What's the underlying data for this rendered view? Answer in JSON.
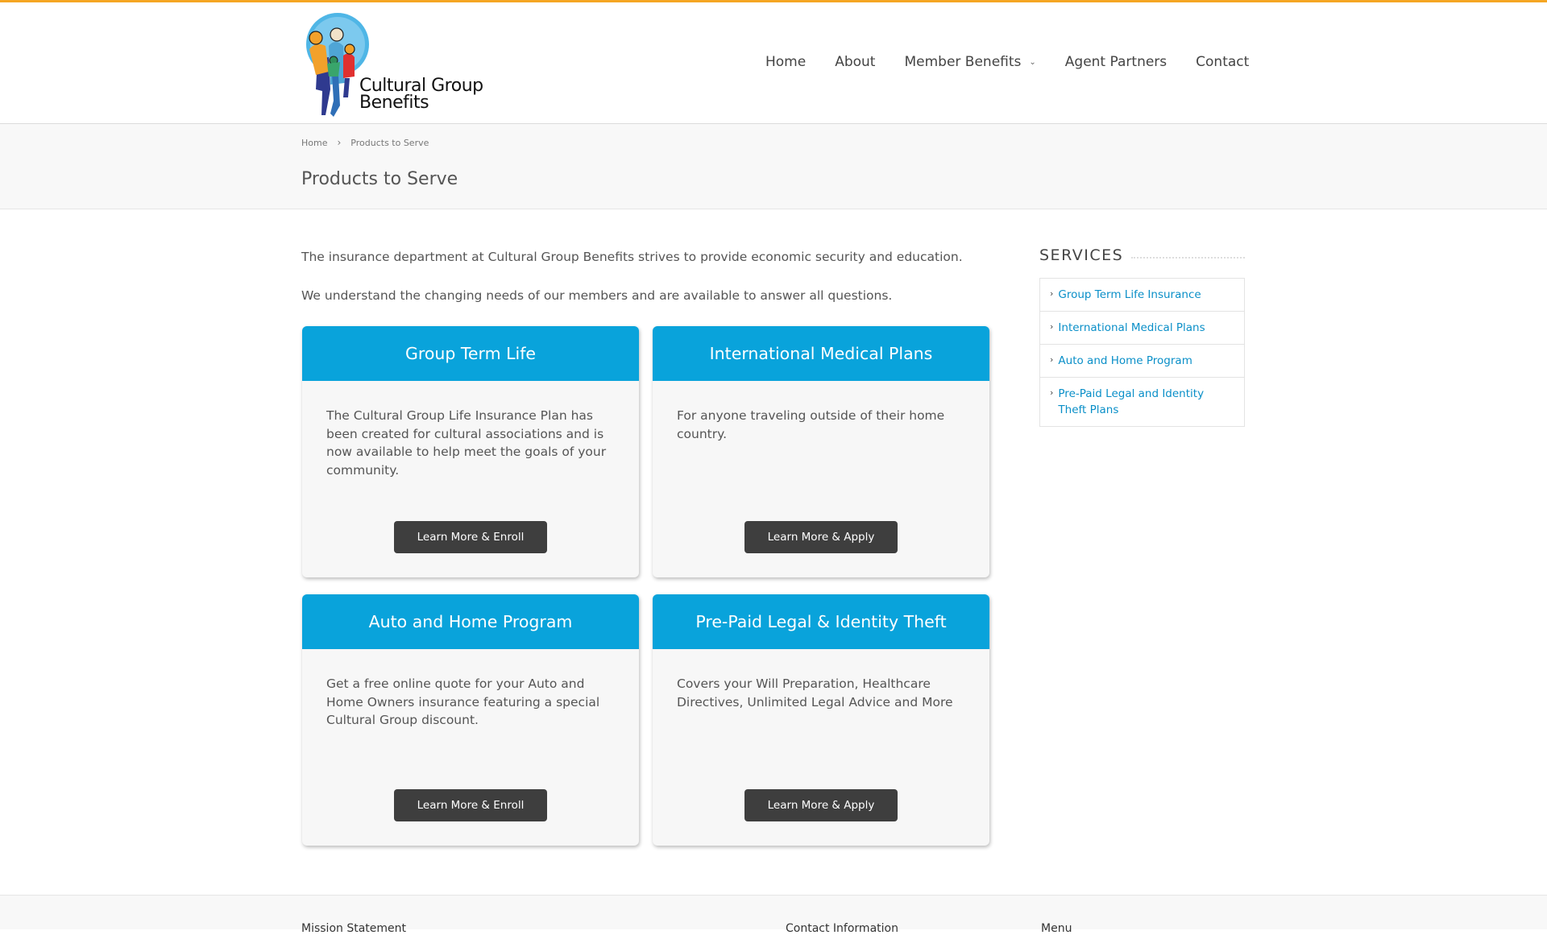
{
  "brand": {
    "name_line1": "Cultural Group",
    "name_line2": "Benefits",
    "accent": "#f5a623",
    "primary": "#09a3db",
    "logo_icon": "family-logo-icon"
  },
  "nav": {
    "items": [
      {
        "label": "Home"
      },
      {
        "label": "About"
      },
      {
        "label": "Member Benefits",
        "has_dropdown": true
      },
      {
        "label": "Agent Partners"
      },
      {
        "label": "Contact"
      }
    ]
  },
  "breadcrumb": {
    "home": "Home",
    "separator": "›",
    "current": "Products to Serve"
  },
  "page": {
    "title": "Products to Serve",
    "intro_1": "The insurance department at Cultural Group Benefits strives to provide economic security and education.",
    "intro_2": "We understand the changing needs of our members and are available to answer all questions."
  },
  "cards": [
    {
      "title": "Group Term Life",
      "body": "The Cultural Group Life Insurance Plan has been created for cultural associations and is now available to help meet the goals of your community.",
      "button": "Learn More & Enroll"
    },
    {
      "title": "International Medical Plans",
      "body": "For anyone traveling outside of their home country.",
      "button": "Learn More & Apply"
    },
    {
      "title": "Auto and Home Program",
      "body": "Get a free online quote for your Auto and Home Owners insurance featuring a special Cultural Group discount.",
      "button": "Learn More & Enroll"
    },
    {
      "title": "Pre-Paid Legal & Identity Theft",
      "body": "Covers your Will Preparation, Healthcare Directives, Unlimited Legal Advice and More",
      "button": "Learn More & Apply"
    }
  ],
  "sidebar": {
    "title": "SERVICES",
    "items": [
      {
        "label": "Group Term Life Insurance"
      },
      {
        "label": "International Medical Plans"
      },
      {
        "label": "Auto and Home Program"
      },
      {
        "label": "Pre-Paid Legal and Identity Theft Plans"
      }
    ]
  },
  "footer": {
    "col1": "Mission Statement",
    "col2": "Contact Information",
    "col3": "Menu"
  }
}
